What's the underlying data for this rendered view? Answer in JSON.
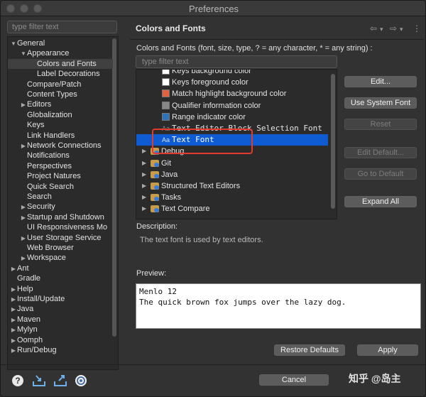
{
  "window": {
    "title": "Preferences"
  },
  "left": {
    "filter_placeholder": "type filter text",
    "tree": [
      {
        "label": "General",
        "level": 0,
        "arrow": "▼"
      },
      {
        "label": "Appearance",
        "level": 1,
        "arrow": "▼"
      },
      {
        "label": "Colors and Fonts",
        "level": 2,
        "arrow": "",
        "selected": true
      },
      {
        "label": "Label Decorations",
        "level": 2,
        "arrow": ""
      },
      {
        "label": "Compare/Patch",
        "level": 1,
        "arrow": ""
      },
      {
        "label": "Content Types",
        "level": 1,
        "arrow": ""
      },
      {
        "label": "Editors",
        "level": 1,
        "arrow": "▶"
      },
      {
        "label": "Globalization",
        "level": 1,
        "arrow": ""
      },
      {
        "label": "Keys",
        "level": 1,
        "arrow": ""
      },
      {
        "label": "Link Handlers",
        "level": 1,
        "arrow": ""
      },
      {
        "label": "Network Connections",
        "level": 1,
        "arrow": "▶"
      },
      {
        "label": "Notifications",
        "level": 1,
        "arrow": ""
      },
      {
        "label": "Perspectives",
        "level": 1,
        "arrow": ""
      },
      {
        "label": "Project Natures",
        "level": 1,
        "arrow": ""
      },
      {
        "label": "Quick Search",
        "level": 1,
        "arrow": ""
      },
      {
        "label": "Search",
        "level": 1,
        "arrow": ""
      },
      {
        "label": "Security",
        "level": 1,
        "arrow": "▶"
      },
      {
        "label": "Startup and Shutdown",
        "level": 1,
        "arrow": "▶"
      },
      {
        "label": "UI Responsiveness Mo",
        "level": 1,
        "arrow": ""
      },
      {
        "label": "User Storage Service",
        "level": 1,
        "arrow": "▶"
      },
      {
        "label": "Web Browser",
        "level": 1,
        "arrow": ""
      },
      {
        "label": "Workspace",
        "level": 1,
        "arrow": "▶"
      },
      {
        "label": "Ant",
        "level": 0,
        "arrow": "▶"
      },
      {
        "label": "Gradle",
        "level": 0,
        "arrow": ""
      },
      {
        "label": "Help",
        "level": 0,
        "arrow": "▶"
      },
      {
        "label": "Install/Update",
        "level": 0,
        "arrow": "▶"
      },
      {
        "label": "Java",
        "level": 0,
        "arrow": "▶"
      },
      {
        "label": "Maven",
        "level": 0,
        "arrow": "▶"
      },
      {
        "label": "Mylyn",
        "level": 0,
        "arrow": "▶"
      },
      {
        "label": "Oomph",
        "level": 0,
        "arrow": "▶"
      },
      {
        "label": "Run/Debug",
        "level": 0,
        "arrow": "▶"
      }
    ]
  },
  "right": {
    "heading": "Colors and Fonts",
    "nav": {
      "back": "⇦",
      "forward": "⇨",
      "menu": "⋮",
      "dropdown": "▾"
    },
    "subtitle": "Colors and Fonts (font, size, type, ? = any character, * = any string) :",
    "filter_placeholder": "type filter text",
    "items": [
      {
        "label": "Keys background color",
        "kind": "color",
        "color": "#ffffff",
        "clipped": true
      },
      {
        "label": "Keys foreground color",
        "kind": "color",
        "color": "#ffffff"
      },
      {
        "label": "Match highlight background color",
        "kind": "color",
        "color": "#e0623f"
      },
      {
        "label": "Qualifier information color",
        "kind": "color",
        "color": "#878787"
      },
      {
        "label": "Range indicator color",
        "kind": "color",
        "color": "#2f73b7"
      },
      {
        "label": "Text Editor Block Selection Font",
        "kind": "font"
      },
      {
        "label": "Text Font",
        "kind": "font",
        "selected": true
      },
      {
        "label": "Debug",
        "kind": "folder",
        "clipped": true
      },
      {
        "label": "Git",
        "kind": "folder"
      },
      {
        "label": "Java",
        "kind": "folder"
      },
      {
        "label": "Structured Text Editors",
        "kind": "folder"
      },
      {
        "label": "Tasks",
        "kind": "folder"
      },
      {
        "label": "Text Compare",
        "kind": "folder"
      }
    ],
    "buttons": {
      "edit": "Edit...",
      "use_system_font": "Use System Font",
      "reset": "Reset",
      "edit_default": "Edit Default...",
      "go_to_default": "Go to Default",
      "expand_all": "Expand All"
    },
    "description_label": "Description:",
    "description_text": "The text font is used by text editors.",
    "preview_label": "Preview:",
    "preview_line1": "Menlo 12",
    "preview_line2": "The quick brown fox jumps over the lazy dog.",
    "restore_defaults": "Restore Defaults",
    "apply": "Apply"
  },
  "bottom": {
    "cancel": "Cancel",
    "watermark": "知乎 @岛主",
    "icons": [
      "help-icon",
      "import-icon",
      "export-icon",
      "oomph-icon"
    ]
  },
  "colors": {
    "selection": "#0f5bd1",
    "annotation_box": "#e23b2e"
  }
}
